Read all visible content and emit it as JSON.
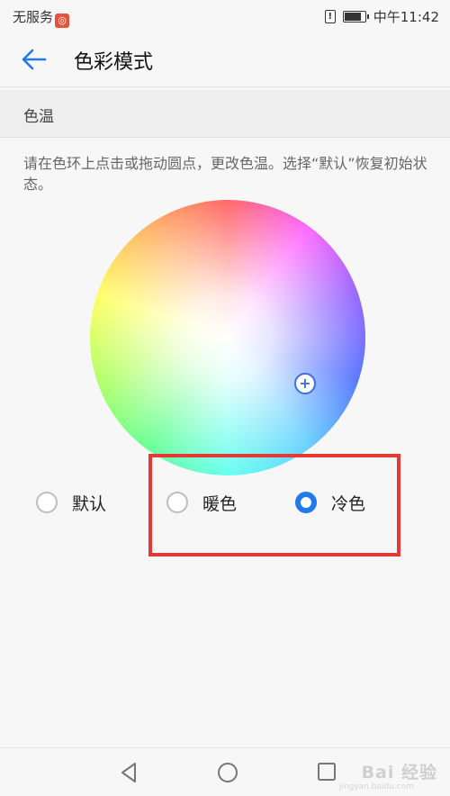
{
  "status_bar": {
    "carrier": "无服务",
    "sim_label": "!",
    "time": "中午11:42",
    "battery_level": 0.85
  },
  "app_bar": {
    "back_icon": "arrow-left-icon",
    "title": "色彩模式"
  },
  "section": {
    "title": "色温"
  },
  "description": "请在色环上点击或拖动圆点，更改色温。选择“默认”恢复初始状态。",
  "color_wheel": {
    "handle_symbol": "+",
    "handle_color": "#3b6fe0"
  },
  "options": [
    {
      "label": "默认",
      "checked": false
    },
    {
      "label": "暖色",
      "checked": false
    },
    {
      "label": "冷色",
      "checked": true
    }
  ],
  "accent_color": "#1f7aeb",
  "highlight_color": "#e53935",
  "nav_bar": {
    "back_icon": "nav-back-triangle-icon",
    "home_icon": "nav-home-circle-icon",
    "recents_icon": "nav-recents-square-icon"
  },
  "watermark": {
    "text": "Bai 经验",
    "sub": "jingyan.baidu.com"
  }
}
